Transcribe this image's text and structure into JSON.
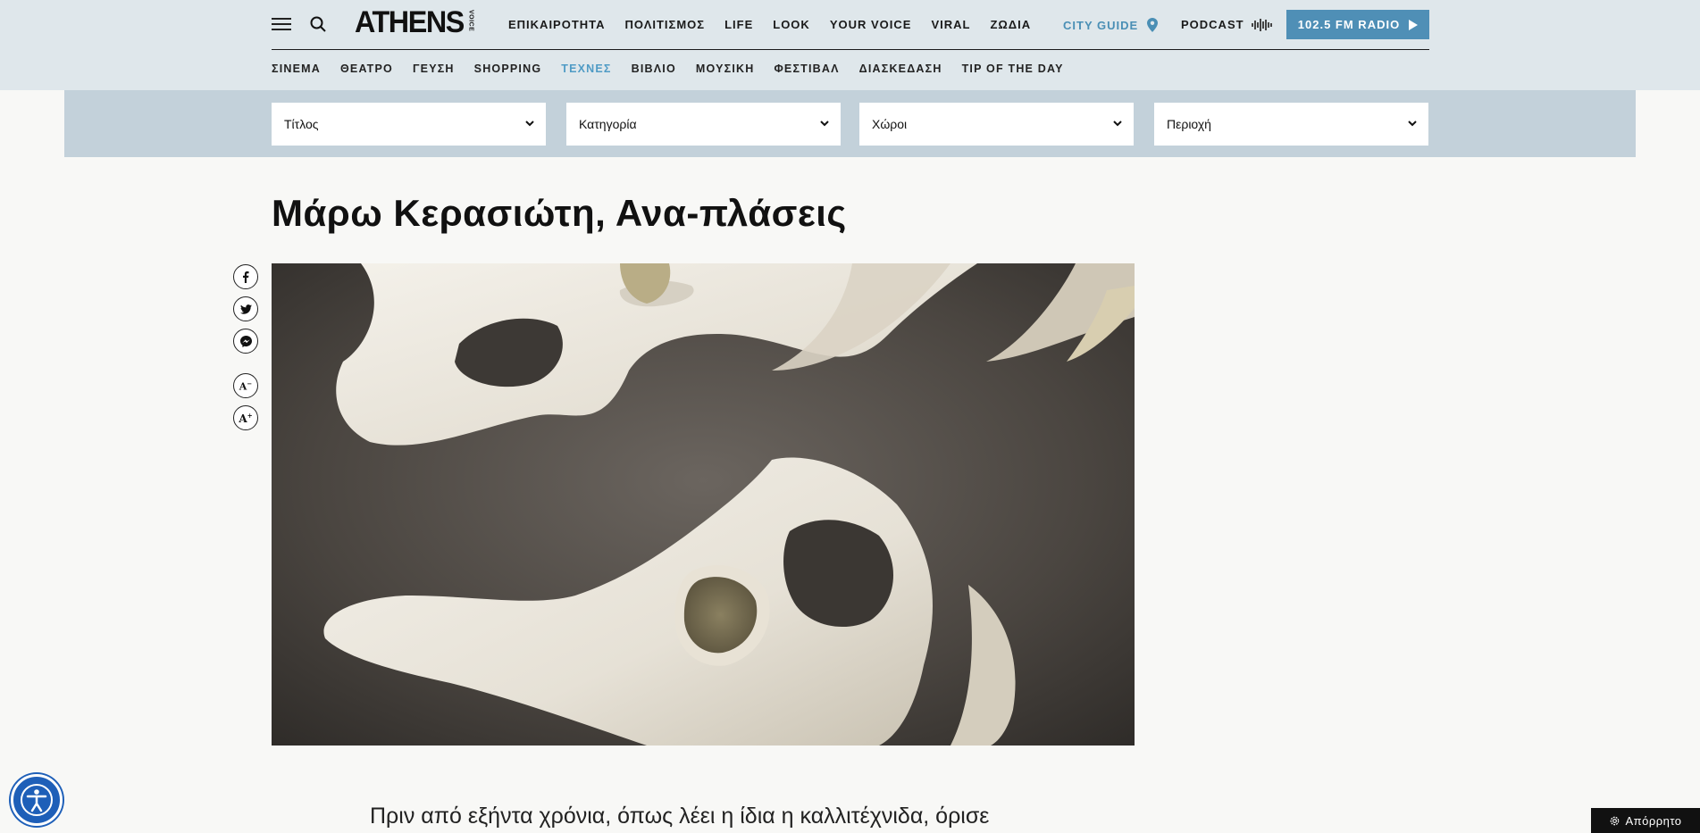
{
  "header": {
    "logo_main": "ATHENS",
    "logo_sub": "VOICE",
    "nav": [
      {
        "label": "ΕΠΙΚΑΙΡΟΤΗΤΑ"
      },
      {
        "label": "ΠΟΛΙΤΙΣΜΟΣ"
      },
      {
        "label": "LIFE"
      },
      {
        "label": "LOOK"
      },
      {
        "label": "YOUR VOICE"
      },
      {
        "label": "VIRAL"
      },
      {
        "label": "ΖΩΔΙΑ"
      }
    ],
    "city_guide": "CITY GUIDE",
    "podcast": "PODCAST",
    "radio": "102.5 FM RADIO",
    "subnav": [
      {
        "label": "ΣΙΝΕΜΑ"
      },
      {
        "label": "ΘΕΑΤΡΟ"
      },
      {
        "label": "ΓΕΥΣΗ"
      },
      {
        "label": "SHOPPING"
      },
      {
        "label": "ΤΕΧΝΕΣ",
        "active": true
      },
      {
        "label": "ΒΙΒΛΙΟ"
      },
      {
        "label": "ΜΟΥΣΙΚΗ"
      },
      {
        "label": "ΦΕΣΤΙΒΑΛ"
      },
      {
        "label": "ΔΙΑΣΚΕΔΑΣΗ"
      },
      {
        "label": "TIP OF THE DAY"
      }
    ],
    "accent_color": "#4f8fb6"
  },
  "filters": [
    {
      "label": "Τίτλος"
    },
    {
      "label": "Κατηγορία"
    },
    {
      "label": "Χώροι"
    },
    {
      "label": "Περιοχή"
    }
  ],
  "article": {
    "title": "Μάρω Κερασιώτη, Ανα-πλάσεις",
    "intro": "Πριν από εξήντα χρόνια, όπως λέει η ίδια η καλλιτέχνιδα, όρισε"
  },
  "share_icons": [
    "facebook-icon",
    "twitter-icon",
    "messenger-icon",
    "font-decrease-icon",
    "font-increase-icon"
  ],
  "privacy_label": "Απόρρητο"
}
